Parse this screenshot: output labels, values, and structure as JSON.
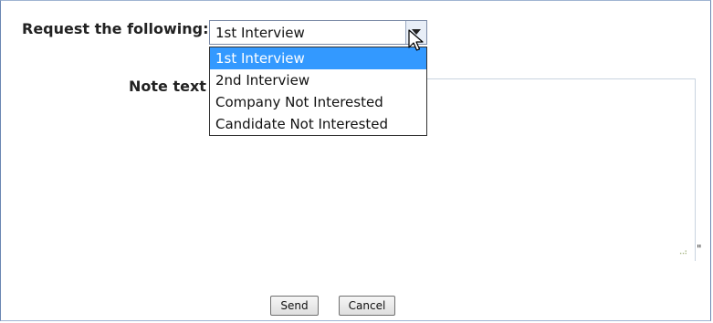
{
  "form": {
    "request_label": "Request the following:",
    "note_label": "Note text",
    "selected_value": "1st Interview",
    "dropdown_options": [
      {
        "label": "1st Interview",
        "selected": true
      },
      {
        "label": "2nd Interview",
        "selected": false
      },
      {
        "label": "Company Not Interested",
        "selected": false
      },
      {
        "label": "Candidate Not Interested",
        "selected": false
      }
    ],
    "quote_mark": "\"",
    "send_label": "Send",
    "cancel_label": "Cancel"
  },
  "colors": {
    "selection": "#3399ff",
    "border": "#6a86b2"
  },
  "icons": [
    "chevron-down-icon",
    "mouse-cursor-icon",
    "resize-grip-icon"
  ]
}
